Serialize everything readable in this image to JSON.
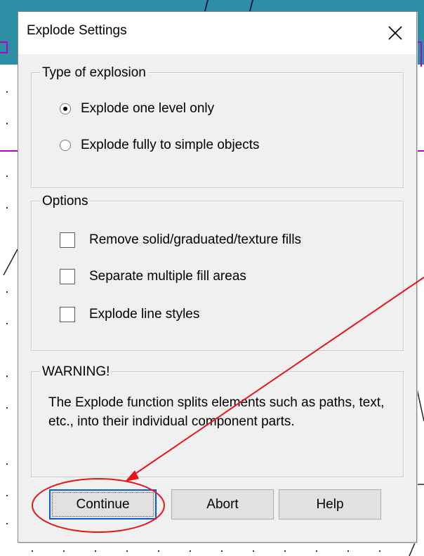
{
  "dialog": {
    "title": "Explode Settings",
    "close_icon": "close-icon"
  },
  "type_group": {
    "legend": "Type of explosion",
    "options": [
      {
        "label": "Explode one level only",
        "selected": true
      },
      {
        "label": "Explode fully to simple objects",
        "selected": false
      }
    ]
  },
  "options_group": {
    "legend": "Options",
    "items": [
      {
        "label": "Remove solid/graduated/texture fills",
        "checked": false
      },
      {
        "label": "Separate multiple fill areas",
        "checked": false
      },
      {
        "label": "Explode line styles",
        "checked": false
      }
    ]
  },
  "warning_group": {
    "legend": "WARNING!",
    "text": "The Explode function splits elements such as paths, text, etc., into their individual component parts."
  },
  "buttons": {
    "continue": "Continue",
    "abort": "Abort",
    "help": "Help"
  },
  "annotation": {
    "color": "#e8141b"
  }
}
